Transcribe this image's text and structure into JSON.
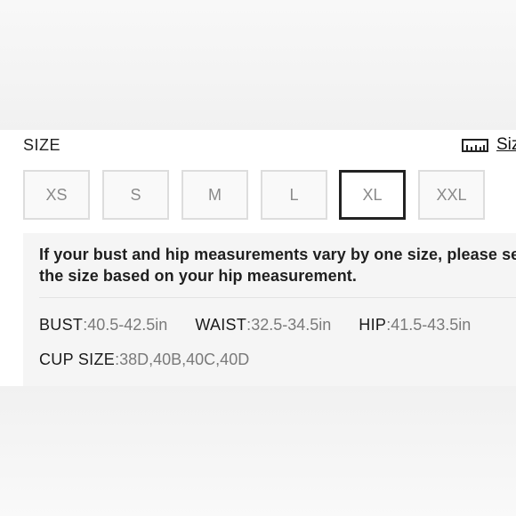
{
  "header": {
    "size_label": "SIZE",
    "size_guide_label": "Size Guide",
    "size_guide_icon": "ruler-icon"
  },
  "sizes": {
    "options": [
      "XS",
      "S",
      "M",
      "L",
      "XL",
      "XXL"
    ],
    "selected": "XL"
  },
  "info": {
    "notice": "If your bust and hip measurements vary by one size, please select the size based on your hip measurement.",
    "bust_label": "BUST",
    "bust_value": "40.5-42.5in",
    "waist_label": "WAIST",
    "waist_value": "32.5-34.5in",
    "hip_label": "HIP",
    "hip_value": "41.5-43.5in",
    "cup_label": "CUP SIZE",
    "cup_value": "38D,40B,40C,40D",
    "separator": ":"
  },
  "colors": {
    "selected_border": "#222222",
    "option_border": "#dddddd",
    "option_text": "#8a8a8a",
    "info_bg": "#f5f5f5"
  }
}
